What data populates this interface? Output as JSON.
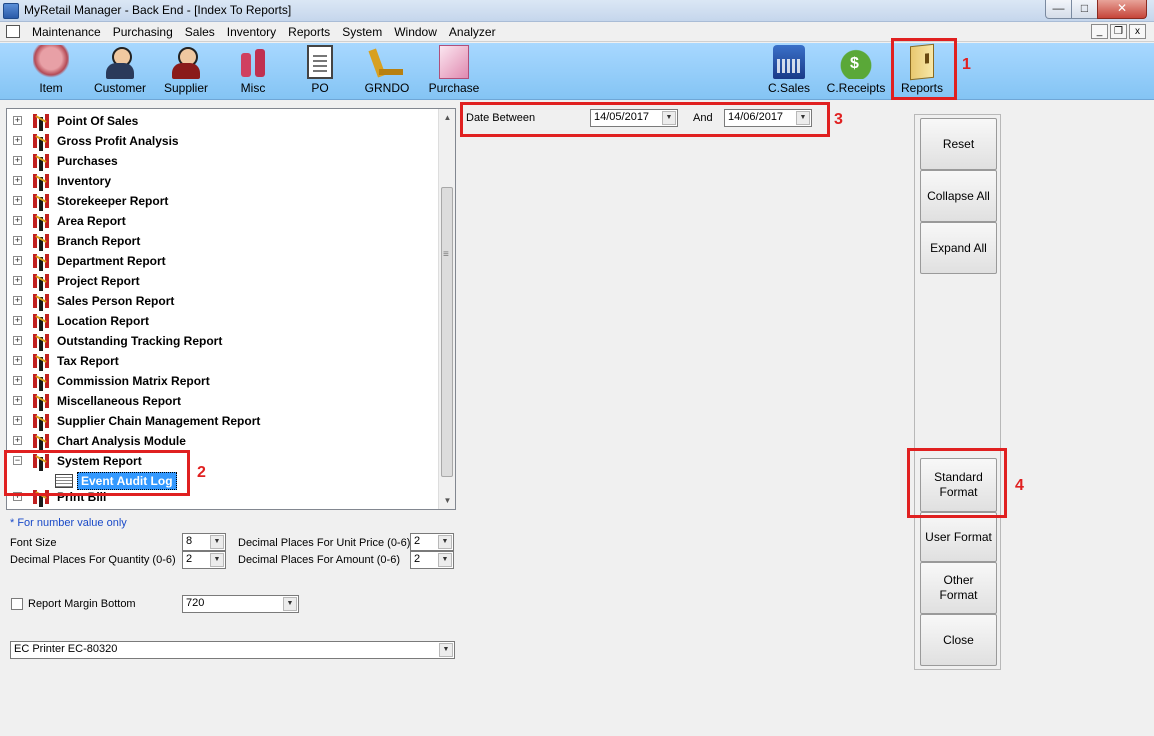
{
  "window": {
    "title": "MyRetail Manager - Back End - [Index To Reports]",
    "min": "0",
    "max": "1",
    "close": "r"
  },
  "menu": [
    "Maintenance",
    "Purchasing",
    "Sales",
    "Inventory",
    "Reports",
    "System",
    "Window",
    "Analyzer"
  ],
  "mdi": [
    "_",
    "❐",
    "x"
  ],
  "toolbar": {
    "item": "Item",
    "customer": "Customer",
    "supplier": "Supplier",
    "misc": "Misc",
    "po": "PO",
    "grndo": "GRNDO",
    "purchase": "Purchase",
    "csales": "C.Sales",
    "creceipts": "C.Receipts",
    "reports": "Reports"
  },
  "annotations": [
    "1",
    "2",
    "3",
    "4"
  ],
  "tree": {
    "items": [
      "Point Of Sales",
      "Gross Profit Analysis",
      "Purchases",
      "Inventory",
      "Storekeeper Report",
      "Area Report",
      "Branch Report",
      "Department Report",
      "Project Report",
      "Sales Person Report",
      "Location Report",
      "Outstanding Tracking Report",
      "Tax Report",
      "Commission Matrix Report",
      "Miscellaneous Report",
      "Supplier Chain Management Report",
      "Chart Analysis Module",
      "System Report"
    ],
    "selected_child": "Event Audit Log",
    "last_item": "Print Bill",
    "expand_collapsed": "+",
    "expand_open": "−"
  },
  "options": {
    "note": "* For number value only",
    "font_size_label": "Font Size",
    "font_size": "8",
    "dp_qty_label": "Decimal Places For Quantity (0-6)",
    "dp_qty": "2",
    "dp_unit_label": "Decimal Places For Unit Price (0-6)",
    "dp_unit": "2",
    "dp_amount_label": "Decimal Places For Amount (0-6)",
    "dp_amount": "2",
    "margin_label": "Report Margin Bottom",
    "margin_value": "720",
    "printer": "EC Printer EC-80320"
  },
  "date": {
    "label": "Date Between",
    "from": "14/05/2017",
    "and_label": "And",
    "to": "14/06/2017"
  },
  "buttons": {
    "reset": "Reset",
    "collapse": "Collapse All",
    "expand": "Expand All",
    "standard": "Standard Format",
    "user": "User Format",
    "other": "Other Format",
    "close": "Close"
  }
}
